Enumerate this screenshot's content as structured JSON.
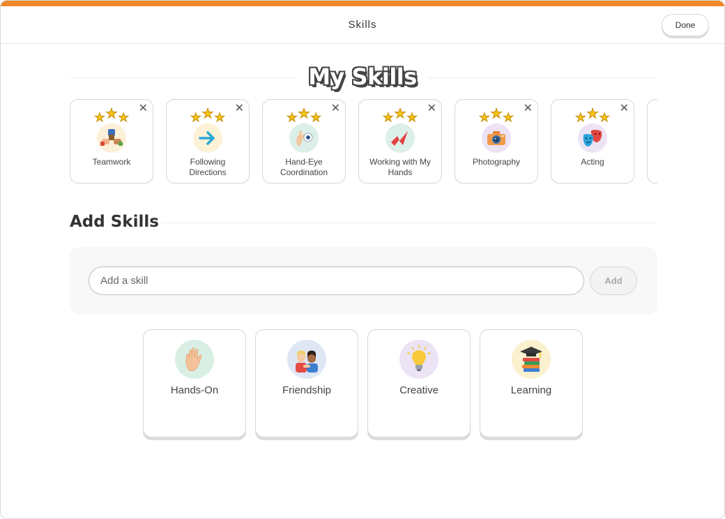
{
  "header": {
    "title": "Skills",
    "done_label": "Done",
    "accent_color": "#f0892b"
  },
  "my_skills": {
    "title": "My Skills",
    "close_glyph": "✕",
    "items": [
      {
        "label": "Teamwork",
        "stars": 3,
        "icon": "fist-bump-icon"
      },
      {
        "label": "Following Directions",
        "stars": 3,
        "icon": "arrow-right-icon"
      },
      {
        "label": "Hand-Eye Coordination",
        "stars": 3,
        "icon": "hand-eye-icon"
      },
      {
        "label": "Working with My Hands",
        "stars": 3,
        "icon": "origami-icon"
      },
      {
        "label": "Photography",
        "stars": 3,
        "icon": "camera-icon"
      },
      {
        "label": "Acting",
        "stars": 3,
        "icon": "theater-masks-icon"
      }
    ]
  },
  "add_skills": {
    "title": "Add Skills",
    "input_placeholder": "Add a skill",
    "input_value": "",
    "add_label": "Add"
  },
  "categories": [
    {
      "label": "Hands-On",
      "icon": "waving-hand-icon"
    },
    {
      "label": "Friendship",
      "icon": "friends-icon"
    },
    {
      "label": "Creative",
      "icon": "lightbulb-icon"
    },
    {
      "label": "Learning",
      "icon": "books-graduation-cap-icon"
    }
  ]
}
